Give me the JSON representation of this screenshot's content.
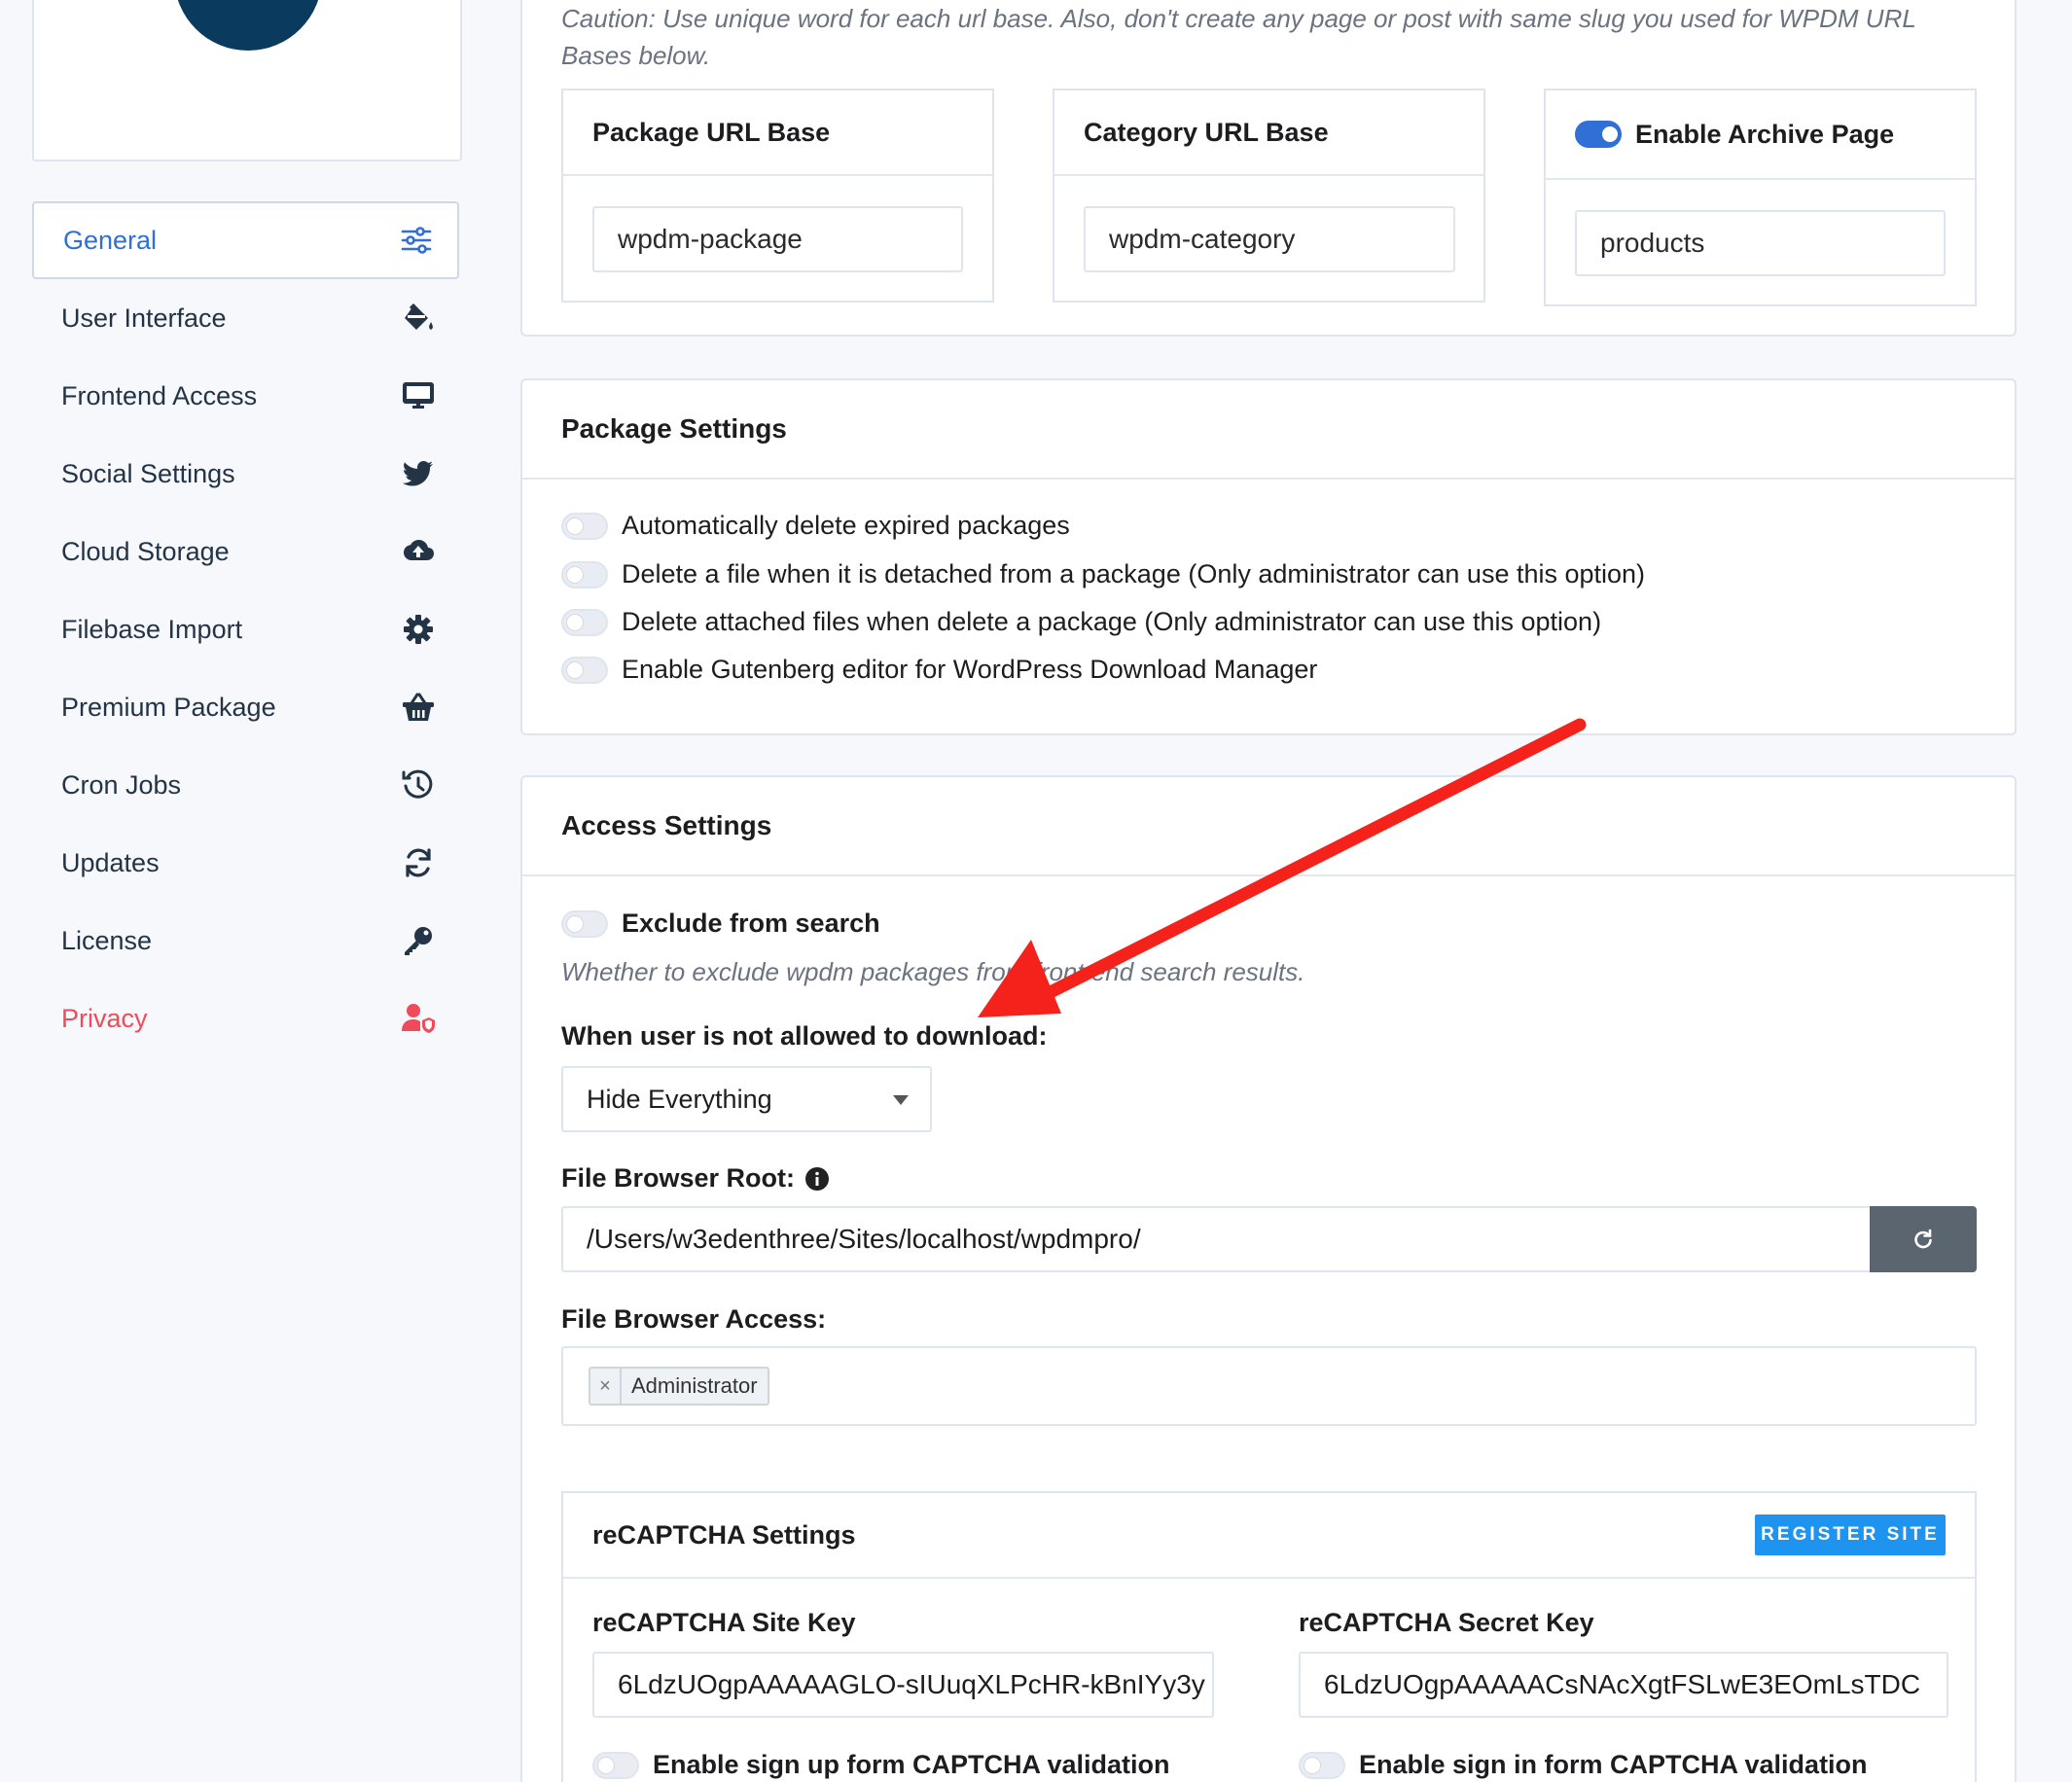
{
  "sidebar": {
    "items": [
      {
        "label": "General",
        "icon": "sliders-icon"
      },
      {
        "label": "User Interface",
        "icon": "paint-bucket-icon"
      },
      {
        "label": "Frontend Access",
        "icon": "monitor-icon"
      },
      {
        "label": "Social Settings",
        "icon": "twitter-icon"
      },
      {
        "label": "Cloud Storage",
        "icon": "cloud-upload-icon"
      },
      {
        "label": "Filebase Import",
        "icon": "gear-icon"
      },
      {
        "label": "Premium Package",
        "icon": "basket-icon"
      },
      {
        "label": "Cron Jobs",
        "icon": "history-icon"
      },
      {
        "label": "Updates",
        "icon": "sync-icon"
      },
      {
        "label": "License",
        "icon": "key-icon"
      },
      {
        "label": "Privacy",
        "icon": "user-shield-icon"
      }
    ]
  },
  "url_bases": {
    "caution": "Caution: Use unique word for each url base. Also, don't create any page or post with same slug you used for WPDM URL Bases below.",
    "package": {
      "label": "Package URL Base",
      "value": "wpdm-package"
    },
    "category": {
      "label": "Category URL Base",
      "value": "wpdm-category"
    },
    "archive": {
      "label": "Enable Archive Page",
      "value": "products",
      "enabled": true
    }
  },
  "package_settings": {
    "title": "Package Settings",
    "options": [
      "Automatically delete expired packages",
      "Delete a file when it is detached from a package (Only administrator can use this option)",
      "Delete attached files when delete a package (Only administrator can use this option)",
      "Enable Gutenberg editor for WordPress Download Manager"
    ]
  },
  "access_settings": {
    "title": "Access Settings",
    "exclude_label": "Exclude from search",
    "exclude_hint": "Whether to exclude wpdm packages from front end search results.",
    "not_allowed_label": "When user is not allowed to download:",
    "not_allowed_value": "Hide Everything",
    "file_root_label": "File Browser Root:",
    "file_root_value": "/Users/w3edenthree/Sites/localhost/wpdmpro/",
    "file_access_label": "File Browser Access:",
    "file_access_tag": "Administrator"
  },
  "recaptcha": {
    "title": "reCAPTCHA Settings",
    "register_label": "REGISTER SITE",
    "site_key_label": "reCAPTCHA Site Key",
    "site_key_value": "6LdzUOgpAAAAAGLO-sIUuqXLPcHR-kBnIYy3y",
    "secret_key_label": "reCAPTCHA Secret Key",
    "secret_key_value": "6LdzUOgpAAAAACsNAcXgtFSLwE3EOmLsTDC",
    "signup_label": "Enable sign up form CAPTCHA validation",
    "signin_label": "Enable sign in form CAPTCHA validation"
  },
  "colors": {
    "accent": "#2f6fd6",
    "privacy": "#f04b5a",
    "annotation_arrow": "#f4221a",
    "register_button": "#1f93f0"
  }
}
